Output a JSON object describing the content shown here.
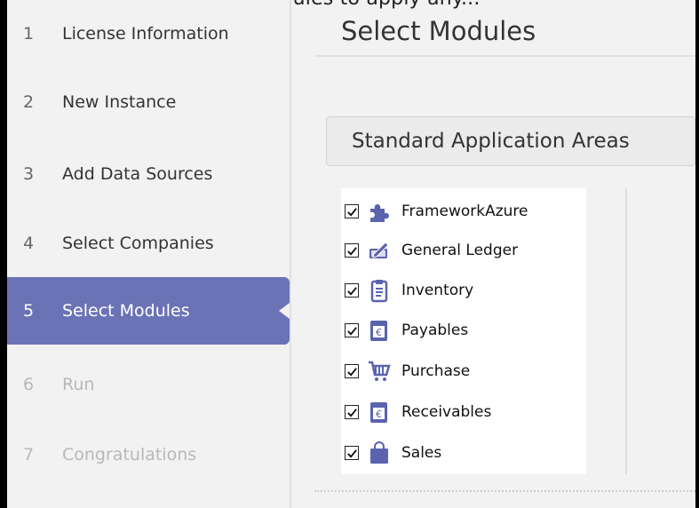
{
  "header_fragment": "Select the modules to apply any...",
  "steps": [
    {
      "num": "1",
      "label": "License Information",
      "state": "normal"
    },
    {
      "num": "2",
      "label": "New Instance",
      "state": "normal"
    },
    {
      "num": "3",
      "label": "Add Data Sources",
      "state": "normal"
    },
    {
      "num": "4",
      "label": "Select Companies",
      "state": "normal"
    },
    {
      "num": "5",
      "label": "Select Modules",
      "state": "active"
    },
    {
      "num": "6",
      "label": "Run",
      "state": "disabled"
    },
    {
      "num": "7",
      "label": "Congratulations",
      "state": "disabled"
    }
  ],
  "main": {
    "title": "Select Modules",
    "area_button": "Standard Application Areas",
    "modules": [
      {
        "label": "FrameworkAzure",
        "checked": true,
        "icon": "puzzle-icon"
      },
      {
        "label": "General Ledger",
        "checked": true,
        "icon": "ledger-pen-icon"
      },
      {
        "label": "Inventory",
        "checked": true,
        "icon": "clipboard-icon"
      },
      {
        "label": "Payables",
        "checked": true,
        "icon": "invoice-euro-icon"
      },
      {
        "label": "Purchase",
        "checked": true,
        "icon": "shopping-cart-icon"
      },
      {
        "label": "Receivables",
        "checked": true,
        "icon": "invoice-euro-icon"
      },
      {
        "label": "Sales",
        "checked": true,
        "icon": "shopping-bag-icon"
      }
    ]
  },
  "colors": {
    "active": "#6b73b6",
    "icon": "#5a63ad",
    "background": "#f2f2f2"
  }
}
